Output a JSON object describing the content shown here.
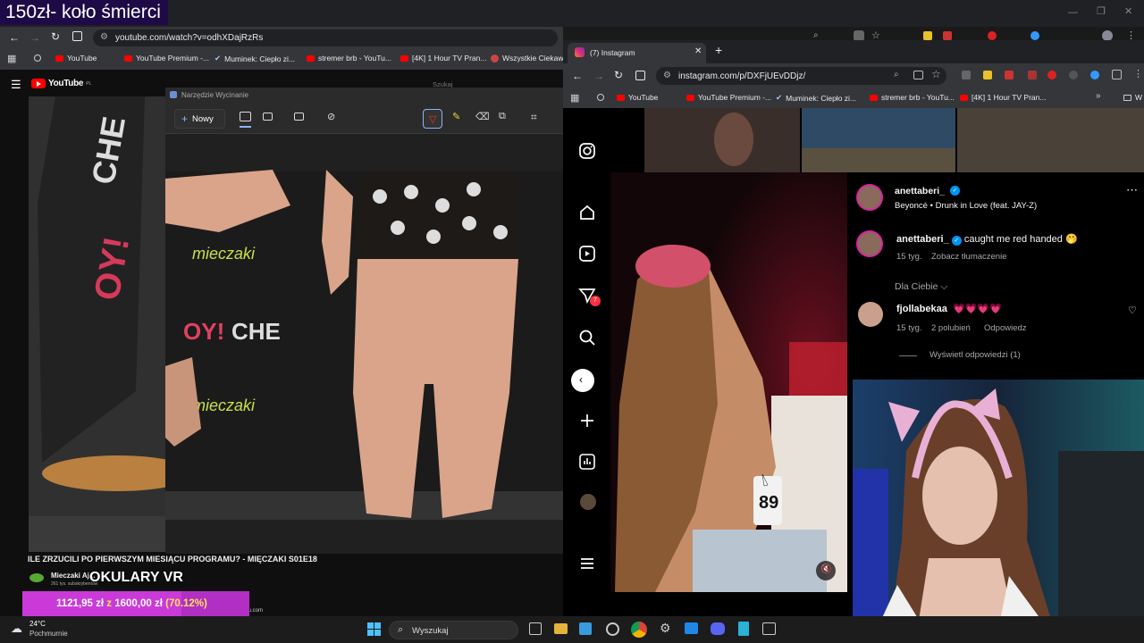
{
  "overlay": {
    "title": "150zł- koło śmierci"
  },
  "left_browser": {
    "url": "youtube.com/watch?v=odhXDajRzRs",
    "bookmarks": [
      "YouTube",
      "YouTube Premium -...",
      "Muminek: Ciepło zi...",
      "stremer brb - YouTu...",
      "[4K] 1 Hour TV Pran...",
      "Wszystkie Ciekawe..."
    ],
    "youtube": {
      "logo": "YouTube",
      "logo_region": "PL",
      "search_placeholder": "Szukaj",
      "video_title": "ILE ZRZUCILI PO PIERWSZYM MIESIĄCU PROGRAMU? - MIĘCZAKI S01E18",
      "channel": "Mieczaki Aj...",
      "subscribers": "261 tys. subskrybentów",
      "ticker": "OKULARY VR",
      "footer_link": "fitatu.com"
    }
  },
  "snipping_tool": {
    "title": "Narzędzie Wycinanie",
    "new_label": "Nowy"
  },
  "right_browser": {
    "tab_title": "(7) Instagram",
    "url": "instagram.com/p/DXFjUEvDDjz/",
    "bookmarks": [
      "YouTube",
      "YouTube Premium -...",
      "Muminek: Ciepło zi...",
      "stremer brb - YouTu...",
      "[4K] 1 Hour TV Pran...",
      "W"
    ],
    "instagram": {
      "nav_badge": "7",
      "author": "anettaberi_",
      "song_artist": "Beyoncé",
      "song_separator": "•",
      "song_title": "Drunk in Love (feat. JAY-Z)",
      "caption_author": "anettaberi_",
      "caption_text": "caught me red handed 🤭",
      "caption_time": "15 tyg.",
      "translate": "Zobacz tłumaczenie",
      "filter_label": "Dla Ciebie",
      "comment_author": "fjollabekaa",
      "comment_text": "💗💗💗💗",
      "comment_time": "15 tyg.",
      "comment_likes": "2 polubień",
      "reply": "Odpowiedz",
      "view_replies": "Wyświetl odpowiedzi (1)",
      "plate": "89"
    }
  },
  "donation": {
    "current": "1121,95 zł",
    "separator": "z",
    "goal": "1600,00 zł",
    "percent": "(70.12%)",
    "progress": 0.7012
  },
  "taskbar": {
    "temperature": "24°C",
    "weather": "Pochmurnie",
    "search": "Wyszukaj"
  },
  "colors": {
    "accent": "#0095f6",
    "youtube_red": "#ff0000",
    "donation_bg": "#b22fc4",
    "donation_text": "#ffe35a"
  }
}
